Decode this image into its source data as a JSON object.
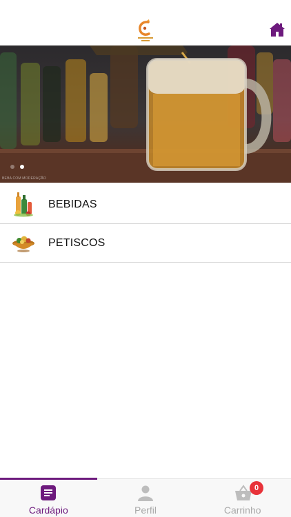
{
  "header": {
    "logo_icon": "bar-logo-icon",
    "home_icon": "home-icon",
    "accent_color": "#6d1a7d"
  },
  "banner": {
    "image": "beer-mug-pour-photo",
    "watermark": "BEBA COM MODERAÇÃO",
    "slide_count": 2,
    "active_slide": 2
  },
  "menu": {
    "items": [
      {
        "label": "BEBIDAS",
        "icon": "drinks-icon"
      },
      {
        "label": "PETISCOS",
        "icon": "snacks-bowl-icon"
      }
    ]
  },
  "tabbar": {
    "tabs": [
      {
        "label": "Cardápio",
        "icon": "menu-list-icon",
        "active": true
      },
      {
        "label": "Perfil",
        "icon": "user-icon",
        "active": false
      },
      {
        "label": "Carrinho",
        "icon": "cart-basket-icon",
        "active": false
      }
    ],
    "cart_count": "0",
    "active_color": "#6d1a7d",
    "inactive_color": "#a9a9a9",
    "badge_color": "#e8333a"
  }
}
